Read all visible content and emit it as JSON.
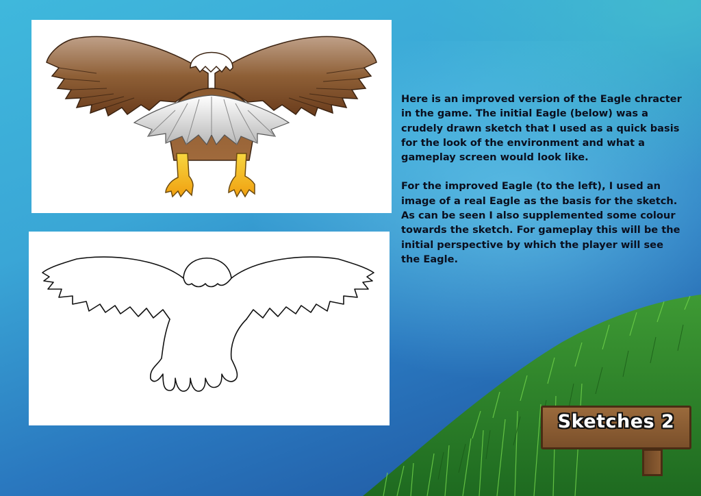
{
  "description": {
    "paragraph1": "Here is an improved version of the Eagle chracter in the game. The initial Eagle (below) was a crudely drawn sketch that I used as a quick basis for the look of the environment and what a gameplay screen would look like.",
    "paragraph2": "For the improved Eagle (to the left), I used an image of a real Eagle as the basis for the sketch. As can be seen I also supplemented some colour towards the sketch. For gameplay this will be the initial perspective by which the player will see the Eagle."
  },
  "sign": {
    "title": "Sketches 2"
  },
  "colors": {
    "background": "#3aa6d6",
    "eagle_brown": "#7a4a24",
    "eagle_talon": "#f2b31c",
    "grass": "#2e8a2a",
    "sign_wood": "#8a5a30"
  }
}
